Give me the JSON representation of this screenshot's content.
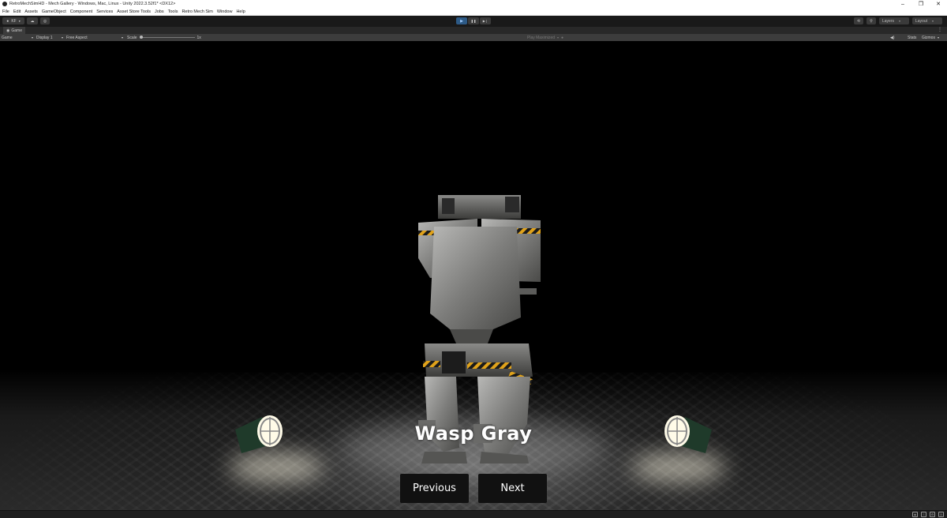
{
  "window": {
    "title": "RetroMechSimHD - Mech Gallery - Windows, Mac, Linux - Unity 2022.3.52f1* <DX12>",
    "controls": [
      "–",
      "❐",
      "✕"
    ]
  },
  "menu": [
    "File",
    "Edit",
    "Assets",
    "GameObject",
    "Component",
    "Services",
    "Asset Store Tools",
    "Jobs",
    "Tools",
    "Retro Mech Sim",
    "Window",
    "Help"
  ],
  "toolbar": {
    "account_label": "KF",
    "play_icon": "▶",
    "pause_icon": "❚❚",
    "step_icon": "▶❘",
    "layers_label": "Layers",
    "layout_label": "Layout"
  },
  "game_tab": {
    "label": "Game"
  },
  "game_bar": {
    "view_select": "Game",
    "display_select": "Display 1",
    "aspect_select": "Free Aspect",
    "scale_label": "Scale",
    "scale_value": "1x",
    "play_mode_select": "Play Maximized",
    "stats_label": "Stats",
    "gizmos_label": "Gizmos"
  },
  "scene": {
    "mech_name": "Wasp Gray",
    "previous_label": "Previous",
    "next_label": "Next"
  },
  "colors": {
    "play_active": "#2d5a86",
    "hazard_yellow": "#e0a21a",
    "button_bg": "#111111"
  }
}
